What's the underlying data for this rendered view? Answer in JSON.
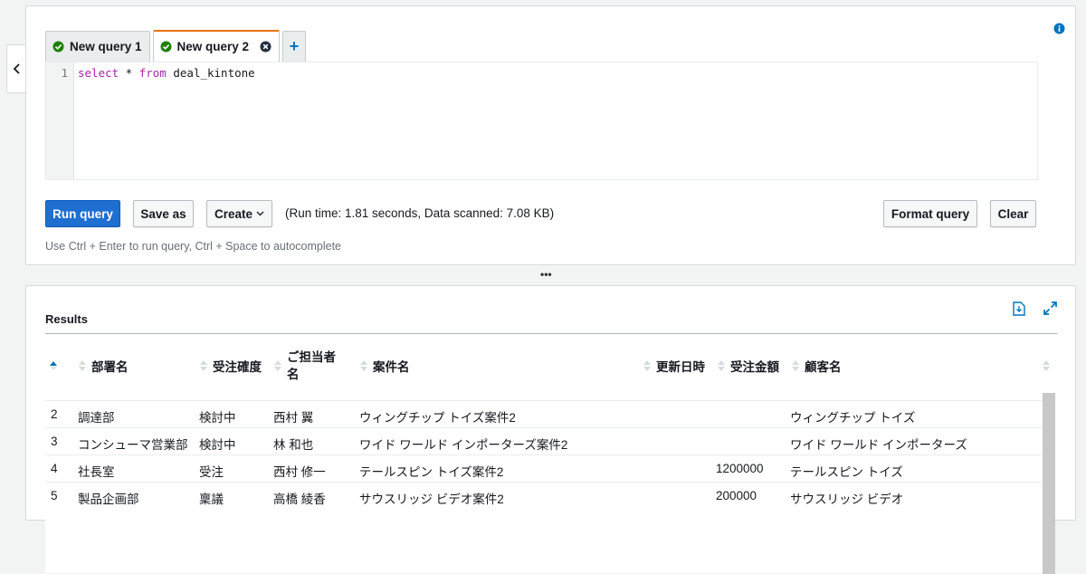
{
  "editor": {
    "tabs": [
      {
        "label": "New query 1",
        "active": false
      },
      {
        "label": "New query 2",
        "active": true
      }
    ],
    "add_tab": "+",
    "line_number": "1",
    "query": {
      "kw_select": "select",
      "star": " * ",
      "kw_from": "from",
      "table": " deal_kintone"
    }
  },
  "toolbar": {
    "run": "Run query",
    "save_as": "Save as",
    "create": "Create",
    "run_info": "(Run time: 1.81 seconds, Data scanned: 7.08 KB)",
    "format": "Format query",
    "clear": "Clear",
    "hint": "Use Ctrl + Enter to run query, Ctrl + Space to autocomplete"
  },
  "splitter": "•••",
  "results": {
    "title": "Results",
    "columns": [
      "部署名",
      "受注確度",
      "ご担当者名",
      "案件名",
      "更新日時",
      "受注金額",
      "顧客名"
    ],
    "rows": [
      {
        "n": "2",
        "dept": "調達部",
        "prob": "検討中",
        "person": "西村 翼",
        "deal": "ウィングチップ トイズ案件2",
        "updated": "",
        "amount": "",
        "customer": "ウィングチップ トイズ"
      },
      {
        "n": "3",
        "dept": "コンシューマ営業部",
        "prob": "検討中",
        "person": "林 和也",
        "deal": "ワイド ワールド インポーターズ案件2",
        "updated": "",
        "amount": "",
        "customer": "ワイド ワールド インポーターズ"
      },
      {
        "n": "4",
        "dept": "社長室",
        "prob": "受注",
        "person": "西村 修一",
        "deal": "テールスピン トイズ案件2",
        "updated": "",
        "amount": "1200000",
        "customer": "テールスピン トイズ"
      },
      {
        "n": "5",
        "dept": "製品企画部",
        "prob": "稟議",
        "person": "高橋 綾香",
        "deal": "サウスリッジ ビデオ案件2",
        "updated": "",
        "amount": "200000",
        "customer": "サウスリッジ ビデオ"
      }
    ]
  },
  "colors": {
    "accent": "#1f6fd1",
    "tab_active": "#ec7211",
    "ok": "#1d8102"
  }
}
